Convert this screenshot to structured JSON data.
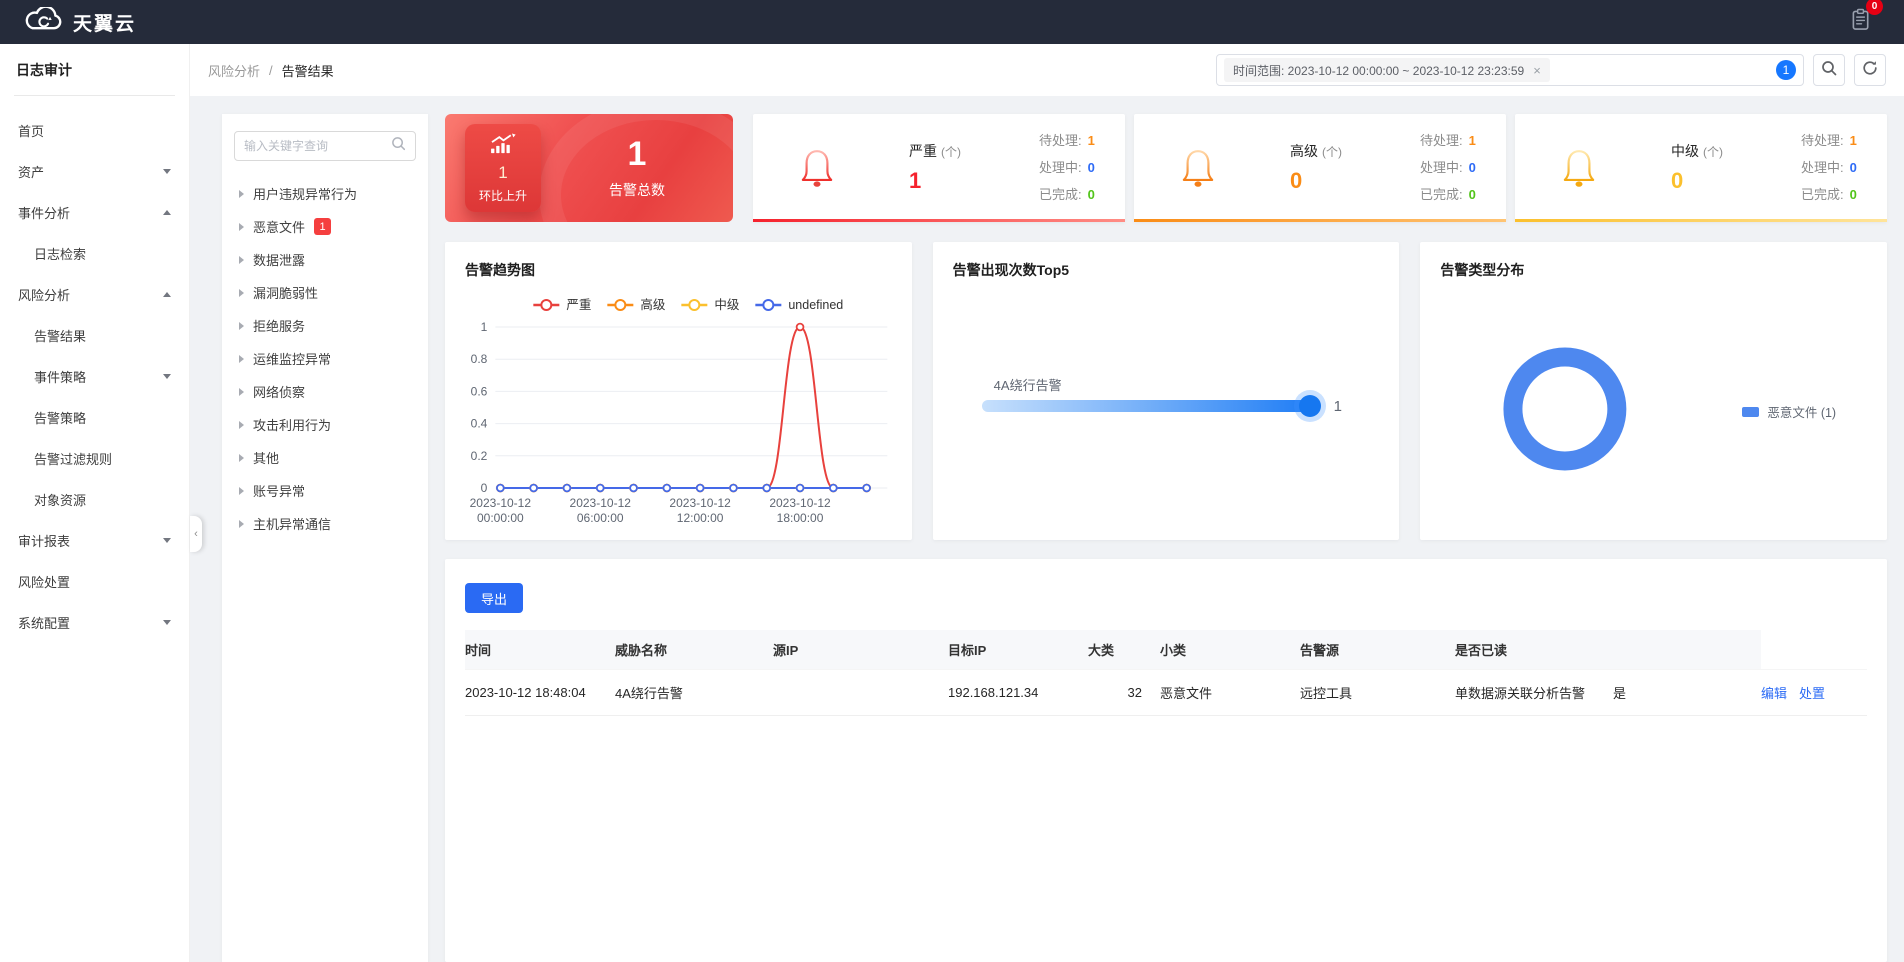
{
  "navbar": {
    "brand": "天翼云",
    "notification_count": "0"
  },
  "header": {
    "breadcrumb": {
      "parent": "风险分析",
      "separator": "/",
      "current": "告警结果"
    },
    "time_filter_tag": "时间范围: 2023-10-12 00:00:00 ~ 2023-10-12 23:23:59",
    "tag_close": "×",
    "match_badge": "1"
  },
  "sidebar": {
    "title": "日志审计",
    "items": [
      {
        "label": "首页",
        "indent": 0,
        "arrow": ""
      },
      {
        "label": "资产",
        "indent": 0,
        "arrow": "down"
      },
      {
        "label": "事件分析",
        "indent": 0,
        "arrow": "up"
      },
      {
        "label": "日志检索",
        "indent": 1,
        "arrow": ""
      },
      {
        "label": "风险分析",
        "indent": 0,
        "arrow": "up"
      },
      {
        "label": "告警结果",
        "indent": 1,
        "arrow": "",
        "active": true
      },
      {
        "label": "事件策略",
        "indent": 1,
        "arrow": "down"
      },
      {
        "label": "告警策略",
        "indent": 1,
        "arrow": ""
      },
      {
        "label": "告警过滤规则",
        "indent": 1,
        "arrow": ""
      },
      {
        "label": "对象资源",
        "indent": 1,
        "arrow": ""
      },
      {
        "label": "审计报表",
        "indent": 0,
        "arrow": "down"
      },
      {
        "label": "风险处置",
        "indent": 0,
        "arrow": ""
      },
      {
        "label": "系统配置",
        "indent": 0,
        "arrow": "down"
      }
    ]
  },
  "category_panel": {
    "search_placeholder": "输入关键字查询",
    "items": [
      {
        "label": "用户违规异常行为"
      },
      {
        "label": "恶意文件",
        "badge": "1"
      },
      {
        "label": "数据泄露"
      },
      {
        "label": "漏洞脆弱性"
      },
      {
        "label": "拒绝服务"
      },
      {
        "label": "运维监控异常"
      },
      {
        "label": "网络侦察"
      },
      {
        "label": "攻击利用行为"
      },
      {
        "label": "其他"
      },
      {
        "label": "账号异常"
      },
      {
        "label": "主机异常通信"
      }
    ]
  },
  "summary": {
    "trend_value": "1",
    "trend_label": "环比上升",
    "total_value": "1",
    "total_label": "告警总数"
  },
  "severity_cards": [
    {
      "name": "严重",
      "unit": "(个)",
      "count": "1",
      "count_color": "#f5222d",
      "bar_color": "#f5222d",
      "stats": [
        {
          "label": "待处理:",
          "value": "1",
          "color": "#fa8c16"
        },
        {
          "label": "处理中:",
          "value": "0",
          "color": "#2e6bf6"
        },
        {
          "label": "已完成:",
          "value": "0",
          "color": "#52c41a"
        }
      ]
    },
    {
      "name": "高级",
      "unit": "(个)",
      "count": "0",
      "count_color": "#fa8c16",
      "bar_color": "#fa8c16",
      "stats": [
        {
          "label": "待处理:",
          "value": "1",
          "color": "#fa8c16"
        },
        {
          "label": "处理中:",
          "value": "0",
          "color": "#2e6bf6"
        },
        {
          "label": "已完成:",
          "value": "0",
          "color": "#52c41a"
        }
      ]
    },
    {
      "name": "中级",
      "unit": "(个)",
      "count": "0",
      "count_color": "#fbc02d",
      "bar_color": "#fbc02d",
      "stats": [
        {
          "label": "待处理:",
          "value": "1",
          "color": "#fa8c16"
        },
        {
          "label": "处理中:",
          "value": "0",
          "color": "#2e6bf6"
        },
        {
          "label": "已完成:",
          "value": "0",
          "color": "#52c41a"
        }
      ]
    }
  ],
  "chart_data": [
    {
      "id": "alert-trend",
      "type": "line",
      "title": "告警趋势图",
      "x": [
        "00:00",
        "02:00",
        "04:00",
        "06:00",
        "08:00",
        "10:00",
        "12:00",
        "14:00",
        "16:00",
        "18:00",
        "20:00",
        "22:00"
      ],
      "x_labels": [
        "2023-10-12 00:00:00",
        "2023-10-12 06:00:00",
        "2023-10-12 12:00:00",
        "2023-10-12 18:00:00"
      ],
      "x_label_indices": [
        0,
        3,
        6,
        9
      ],
      "ylim": [
        0,
        1
      ],
      "yticks": [
        0,
        0.2,
        0.4,
        0.6,
        0.8,
        1
      ],
      "grid": true,
      "legend_position": "top",
      "series": [
        {
          "name": "严重",
          "color": "#e8413d",
          "values": [
            0,
            0,
            0,
            0,
            0,
            0,
            0,
            0,
            0,
            1,
            0,
            0
          ]
        },
        {
          "name": "高级",
          "color": "#fa8c16",
          "values": [
            0,
            0,
            0,
            0,
            0,
            0,
            0,
            0,
            0,
            0,
            0,
            0
          ]
        },
        {
          "name": "中级",
          "color": "#fbc02d",
          "values": [
            0,
            0,
            0,
            0,
            0,
            0,
            0,
            0,
            0,
            0,
            0,
            0
          ]
        },
        {
          "name": "undefined",
          "color": "#4569e8",
          "values": [
            0,
            0,
            0,
            0,
            0,
            0,
            0,
            0,
            0,
            0,
            0,
            0
          ]
        }
      ]
    },
    {
      "id": "alert-top5",
      "type": "bar",
      "title": "告警出现次数Top5",
      "orientation": "horizontal",
      "categories": [
        "4A绕行告警"
      ],
      "values": [
        1
      ],
      "max": 1,
      "bar_color": "#1f7df5"
    },
    {
      "id": "alert-type-distribution",
      "type": "pie",
      "title": "告警类型分布",
      "donut": true,
      "slices": [
        {
          "label": "恶意文件",
          "value": 1,
          "color": "#4e88ef"
        }
      ],
      "legend": [
        {
          "text": "恶意文件 (1)"
        }
      ]
    }
  ],
  "table": {
    "export_label": "导出",
    "headers": [
      "时间",
      "威胁名称",
      "源IP",
      "目标IP",
      "大类",
      "小类",
      "告警源",
      "是否已读",
      "",
      ""
    ],
    "rows": [
      {
        "cells": [
          "2023-10-12 18:48:04",
          "4A绕行告警",
          "",
          "192.168.121.34",
          "32",
          "恶意文件",
          "远控工具",
          "单数据源关联分析告警",
          "是"
        ],
        "actions": [
          "编辑",
          "处置"
        ]
      }
    ]
  }
}
